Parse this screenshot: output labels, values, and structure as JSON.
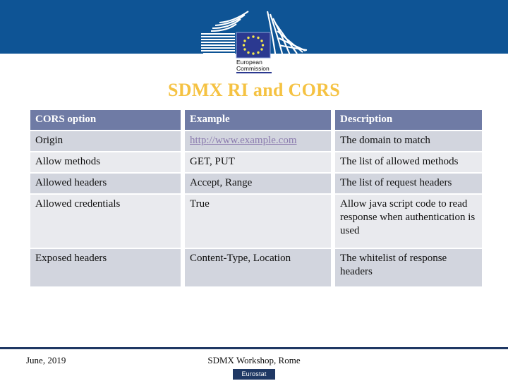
{
  "header": {
    "banner_color": "#0E5495",
    "logo": {
      "name": "european-commission-logo",
      "line1": "European",
      "line2": "Commission"
    }
  },
  "slide": {
    "title": "SDMX RI and CORS",
    "title_color": "#F5C242"
  },
  "table": {
    "header_bg": "#6F7BA5",
    "row_odd_bg": "#D2D5DE",
    "row_even_bg": "#E9EAEE",
    "link_color": "#8B7BAE",
    "columns": [
      "CORS option",
      "Example",
      "Description"
    ],
    "rows": [
      {
        "option": "Origin",
        "example": "http://www.example.com",
        "example_is_link": true,
        "description": "The domain to match"
      },
      {
        "option": "Allow methods",
        "example": "GET, PUT",
        "example_is_link": false,
        "description": "The list of allowed methods"
      },
      {
        "option": "Allowed headers",
        "example": "Accept, Range",
        "example_is_link": false,
        "description": "The list of request headers"
      },
      {
        "option": "Allowed credentials",
        "example": "True",
        "example_is_link": false,
        "description": "Allow java script code to read response when authentication is used"
      },
      {
        "option": "Exposed headers",
        "example": "Content-Type, Location",
        "example_is_link": false,
        "description": "The whitelist of response headers"
      }
    ]
  },
  "footer": {
    "date": "June, 2019",
    "event": "SDMX Workshop, Rome",
    "badge": "Eurostat",
    "rule_color": "#1F3864"
  }
}
